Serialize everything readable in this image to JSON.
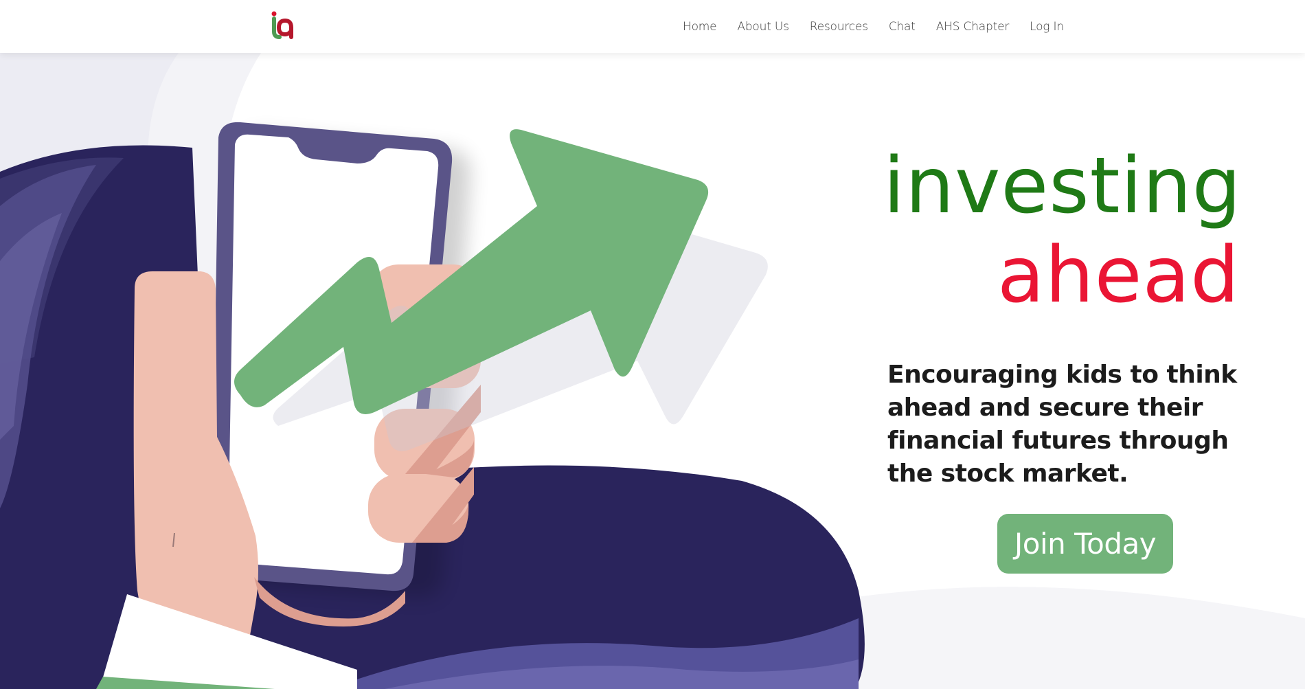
{
  "header": {
    "logo_name": "ia-logo",
    "nav": [
      {
        "label": "Home"
      },
      {
        "label": "About Us"
      },
      {
        "label": "Resources"
      },
      {
        "label": "Chat"
      },
      {
        "label": "AHS Chapter"
      },
      {
        "label": "Log In"
      }
    ]
  },
  "hero": {
    "headline_line1": "investing",
    "headline_line2": "ahead",
    "tagline": "Encouraging kids to think ahead and secure their financial futures through the stock market.",
    "cta_label": "Join Today"
  },
  "colors": {
    "green_dark": "#1f7a16",
    "red": "#ea1534",
    "cta_green": "#72b37a",
    "navy": "#2a245c",
    "purple": "#55529a",
    "skin": "#f0bfb0"
  }
}
